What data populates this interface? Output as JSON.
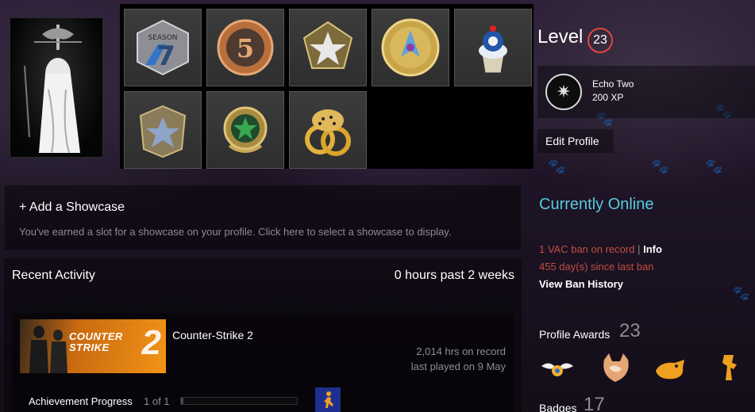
{
  "level": {
    "label": "Level",
    "value": "23"
  },
  "featured_badge": {
    "name": "Echo Two",
    "xp": "200 XP",
    "icon": "sparkle-icon"
  },
  "edit_profile": "Edit Profile",
  "badges_grid": [
    {
      "name": "season-7-coin"
    },
    {
      "name": "5-year-veteran-coin"
    },
    {
      "name": "service-medal-star"
    },
    {
      "name": "operation-coin"
    },
    {
      "name": "cupcake-pin"
    },
    {
      "name": "service-medal-silver"
    },
    {
      "name": "service-medal-green"
    },
    {
      "name": "leopard-ring-pin"
    }
  ],
  "showcase": {
    "title": "+ Add a Showcase",
    "description": "You've earned a slot for a showcase on your profile. Click here to select a showcase to display."
  },
  "activity": {
    "title": "Recent Activity",
    "hours": "0 hours past 2 weeks",
    "game": {
      "name": "Counter-Strike 2",
      "capsule_text": "COUNTER STRIKE",
      "capsule_number": "2",
      "hours_on_record": "2,014 hrs on record",
      "last_played": "last played on 9 May",
      "achievement_label": "Achievement Progress",
      "achievement_count": "1 of 1",
      "achievement_fraction": 0.02
    }
  },
  "status": {
    "online": "Currently Online",
    "vac": "1 VAC ban on record",
    "vac_separator": "|",
    "info": "Info",
    "since_ban": "455 day(s) since last ban",
    "ban_history": "View Ban History"
  },
  "awards": {
    "label": "Profile Awards",
    "count": "23"
  },
  "badges": {
    "label": "Badges",
    "count": "17"
  },
  "colors": {
    "online": "#57cbde",
    "ban": "#c34d45",
    "level_ring": "#e0463f"
  }
}
